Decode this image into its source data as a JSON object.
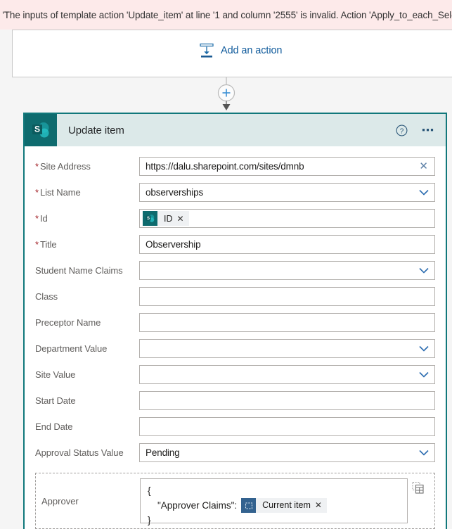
{
  "error": {
    "message": ": 'The inputs of template action 'Update_item' at line '1 and column '2555' is invalid. Action 'Apply_to_each_Select_Data_Op"
  },
  "top_card": {
    "add_action_label": "Add an action",
    "add_action_icon": "insert-arrow-down-icon"
  },
  "connector": {
    "insert_icon": "plus-circle-icon",
    "arrow_icon": "arrow-down-icon"
  },
  "action_card": {
    "title": "Update item",
    "connector_icon": "sharepoint-icon",
    "help_icon": "help-circle-icon",
    "menu_icon": "ellipsis-icon",
    "accent_color": "#11787b",
    "header_bg": "#dce9e9"
  },
  "fields": [
    {
      "label": "Site Address",
      "required": true,
      "type": "text-clear",
      "value": "https://dalu.sharepoint.com/sites/dmnb",
      "trailing_icon": "close-icon"
    },
    {
      "label": "List Name",
      "required": true,
      "type": "dropdown",
      "value": "observerships",
      "trailing_icon": "chevron-down-icon"
    },
    {
      "label": "Id",
      "required": true,
      "type": "token",
      "value": "",
      "token": {
        "label": "ID",
        "icon": "sharepoint-icon",
        "remove_icon": "close-icon"
      }
    },
    {
      "label": "Title",
      "required": true,
      "type": "text",
      "value": "Observership"
    },
    {
      "label": "Student Name Claims",
      "required": false,
      "type": "dropdown",
      "value": "",
      "trailing_icon": "chevron-down-icon"
    },
    {
      "label": "Class",
      "required": false,
      "type": "text",
      "value": ""
    },
    {
      "label": "Preceptor Name",
      "required": false,
      "type": "text",
      "value": ""
    },
    {
      "label": "Department Value",
      "required": false,
      "type": "dropdown",
      "value": "",
      "trailing_icon": "chevron-down-icon"
    },
    {
      "label": "Site Value",
      "required": false,
      "type": "dropdown",
      "value": "",
      "trailing_icon": "chevron-down-icon"
    },
    {
      "label": "Start Date",
      "required": false,
      "type": "text",
      "value": ""
    },
    {
      "label": "End Date",
      "required": false,
      "type": "text",
      "value": ""
    },
    {
      "label": "Approval Status Value",
      "required": false,
      "type": "dropdown",
      "value": "Pending",
      "trailing_icon": "chevron-down-icon"
    }
  ],
  "approver": {
    "label": "Approver",
    "json_open": "{",
    "json_key": "\"Approver Claims\":",
    "json_close": "}",
    "token": {
      "label": "Current item",
      "icon": "dynamic-content-icon",
      "remove_icon": "close-icon"
    },
    "picker_icon": "dynamic-content-picker-icon"
  }
}
